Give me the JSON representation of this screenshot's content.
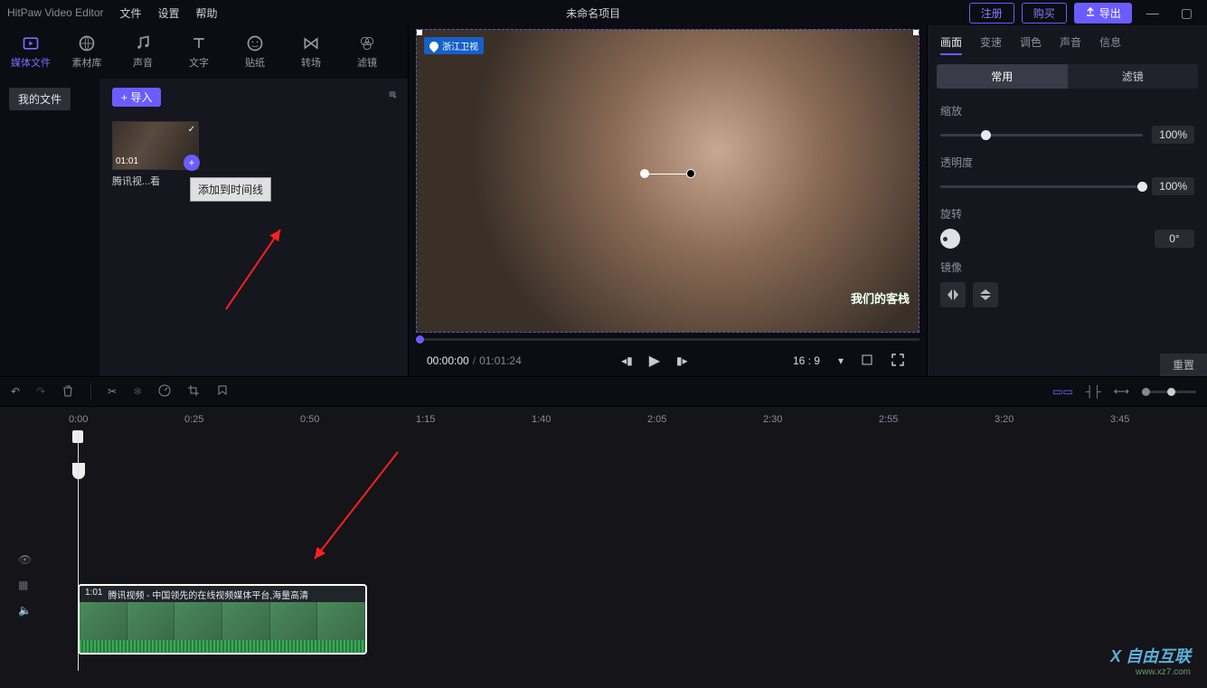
{
  "titlebar": {
    "app": "HitPaw Video Editor",
    "menu": [
      "文件",
      "设置",
      "帮助"
    ],
    "project": "未命名项目",
    "register": "注册",
    "buy": "购买",
    "export": "导出"
  },
  "tabs": [
    {
      "icon": "media",
      "label": "媒体文件",
      "active": true
    },
    {
      "icon": "stock",
      "label": "素材库"
    },
    {
      "icon": "audio",
      "label": "声音"
    },
    {
      "icon": "text",
      "label": "文字"
    },
    {
      "icon": "sticker",
      "label": "贴纸"
    },
    {
      "icon": "trans",
      "label": "转场"
    },
    {
      "icon": "filter",
      "label": "滤镜"
    }
  ],
  "media": {
    "folder": "我的文件",
    "import": "+ 导入",
    "thumb": {
      "dur": "01:01",
      "title": "腾讯视...看"
    },
    "tooltip": "添加到时间线"
  },
  "preview": {
    "channel": "浙江卫视",
    "show_logo": "我们的客栈",
    "time_cur": "00:00:00",
    "time_total": "01:01:24",
    "ratio": "16 : 9"
  },
  "rpanel": {
    "tabs": [
      "画面",
      "变速",
      "调色",
      "声音",
      "信息"
    ],
    "subtabs": [
      "常用",
      "滤镜"
    ],
    "scale": {
      "label": "缩放",
      "value": "100%",
      "pos": 20
    },
    "opacity": {
      "label": "透明度",
      "value": "100%",
      "pos": 100
    },
    "rotation": {
      "label": "旋转",
      "value": "0°"
    },
    "mirror": {
      "label": "镜像"
    },
    "reset": "重置"
  },
  "ruler": [
    "0:00",
    "0:25",
    "0:50",
    "1:15",
    "1:40",
    "2:05",
    "2:30",
    "2:55",
    "3:20",
    "3:45"
  ],
  "clip": {
    "dur": "1:01",
    "title": "腾讯视频 - 中国领先的在线视频媒体平台,海量高清"
  },
  "watermark": {
    "brand": "自由互联",
    "url": "www.xz7.com"
  }
}
